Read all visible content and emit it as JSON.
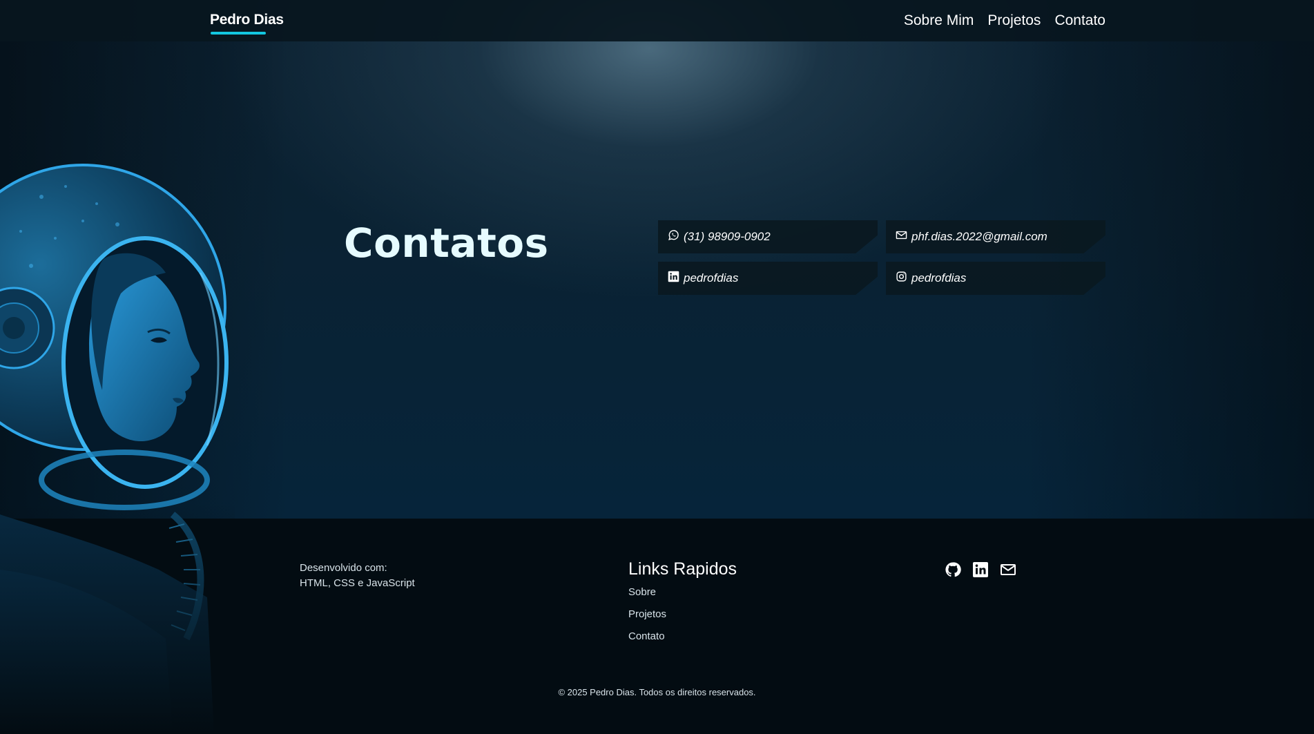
{
  "navbar": {
    "brand": "Pedro Dias",
    "links": [
      "Sobre Mim",
      "Projetos",
      "Contato"
    ]
  },
  "contact": {
    "title": "Contatos",
    "cards": [
      {
        "icon": "whatsapp-icon",
        "text": "(31) 98909-0902"
      },
      {
        "icon": "mail-icon",
        "text": "phf.dias.2022@gmail.com"
      },
      {
        "icon": "linkedin-icon",
        "text": "pedrofdias"
      },
      {
        "icon": "instagram-icon",
        "text": "pedrofdias"
      }
    ]
  },
  "footer": {
    "dev_label": "Desenvolvido com:",
    "dev_tech": "HTML, CSS e JavaScript",
    "links_title": "Links Rapidos",
    "links": [
      "Sobre",
      "Projetos",
      "Contato"
    ],
    "social": [
      "github-icon",
      "linkedin-icon",
      "mail-icon"
    ],
    "copyright": "© 2025 Pedro Dias. Todos os direitos reservados."
  },
  "colors": {
    "accent": "#13c6e0",
    "background": "#030d14",
    "astronaut": "#1a8fd0"
  }
}
